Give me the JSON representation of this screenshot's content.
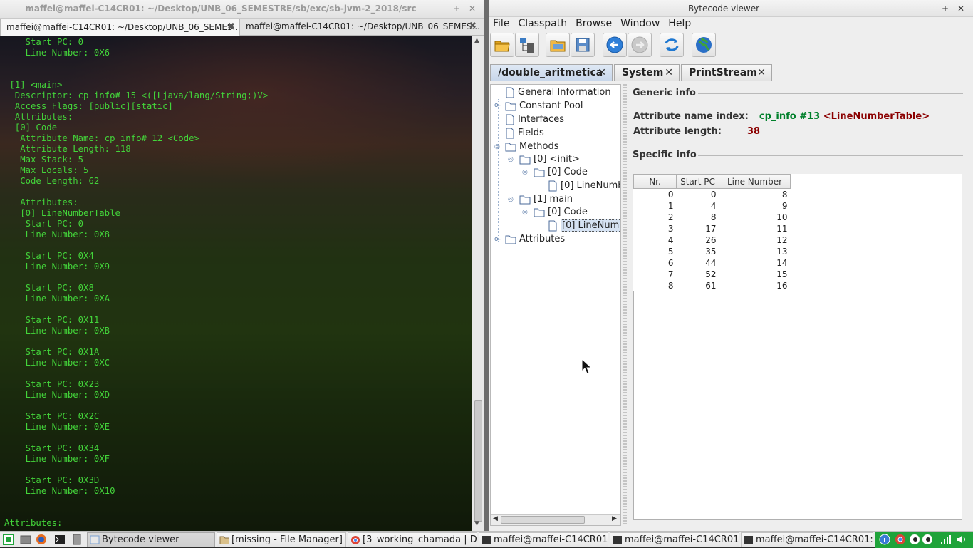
{
  "terminal": {
    "window_title": "maffei@maffei-C14CR01: ~/Desktop/UNB_06_SEMESTRE/sb/exc/sb-jvm-2_2018/src",
    "tabs": [
      {
        "label": "maffei@maffei-C14CR01: ~/Desktop/UNB_06_SEMES..."
      },
      {
        "label": "maffei@maffei-C14CR01: ~/Desktop/UNB_06_SEMES..."
      }
    ],
    "output": "    Start PC: 0\n    Line Number: 0X6\n\n\n [1] <main>\n  Descriptor: cp_info# 15 <([Ljava/lang/String;)V>\n  Access Flags: [public][static]\n  Attributes:\n  [0] Code\n   Attribute Name: cp_info# 12 <Code>\n   Attribute Length: 118\n   Max Stack: 5\n   Max Locals: 5\n   Code Length: 62\n\n   Attributes:\n   [0] LineNumberTable\n    Start PC: 0\n    Line Number: 0X8\n\n    Start PC: 0X4\n    Line Number: 0X9\n\n    Start PC: 0X8\n    Line Number: 0XA\n\n    Start PC: 0X11\n    Line Number: 0XB\n\n    Start PC: 0X1A\n    Line Number: 0XC\n\n    Start PC: 0X23\n    Line Number: 0XD\n\n    Start PC: 0X2C\n    Line Number: 0XE\n\n    Start PC: 0X34\n    Line Number: 0XF\n\n    Start PC: 0X3D\n    Line Number: 0X10\n\n\nAttributes:"
  },
  "viewer": {
    "window_title": "Bytecode viewer",
    "menu": [
      "File",
      "Classpath",
      "Browse",
      "Window",
      "Help"
    ],
    "toolbar_icons": [
      "open-folder-icon",
      "hierarchy-icon",
      "folder-icon",
      "save-icon",
      "back-arrow-icon",
      "forward-arrow-icon",
      "refresh-icon",
      "globe-icon"
    ],
    "doc_tabs": [
      {
        "label": "/double_aritmetica",
        "active": true
      },
      {
        "label": "System",
        "active": false
      },
      {
        "label": "PrintStream",
        "active": false
      }
    ],
    "tree": {
      "general_information": "General Information",
      "constant_pool": "Constant Pool",
      "interfaces": "Interfaces",
      "fields": "Fields",
      "methods": "Methods",
      "init": "[0] <init>",
      "init_code": "[0] Code",
      "init_lnt": "[0] LineNumb",
      "main": "[1] main",
      "main_code": "[0] Code",
      "main_lnt": "[0] LineNumb",
      "attributes": "Attributes"
    },
    "detail": {
      "generic_title": "Generic info",
      "name_index_label": "Attribute name index:",
      "name_index_link": "cp_info #13",
      "name_index_value": "<LineNumberTable>",
      "length_label": "Attribute length:",
      "length_value": "38",
      "specific_title": "Specific info",
      "columns": [
        "Nr.",
        "Start PC",
        "Line Number"
      ],
      "rows": [
        [
          "0",
          "0",
          "8"
        ],
        [
          "1",
          "4",
          "9"
        ],
        [
          "2",
          "8",
          "10"
        ],
        [
          "3",
          "17",
          "11"
        ],
        [
          "4",
          "26",
          "12"
        ],
        [
          "5",
          "35",
          "13"
        ],
        [
          "6",
          "44",
          "14"
        ],
        [
          "7",
          "52",
          "15"
        ],
        [
          "8",
          "61",
          "16"
        ]
      ]
    }
  },
  "taskbar": {
    "tasks": [
      {
        "label": "Bytecode viewer",
        "active": true
      },
      {
        "label": "[missing - File Manager]",
        "active": false
      },
      {
        "label": "[3_working_chamada | Di...",
        "active": false
      },
      {
        "label": "maffei@maffei-C14CR01: ...",
        "active": false
      },
      {
        "label": "maffei@maffei-C14CR01: ...",
        "active": false
      },
      {
        "label": "maffei@maffei-C14CR01: ...",
        "active": false
      }
    ]
  },
  "colors": {
    "terminal_text": "#43d43a",
    "link": "#00802b",
    "value_red": "#8b0000",
    "tray_green": "#1fa33a"
  }
}
